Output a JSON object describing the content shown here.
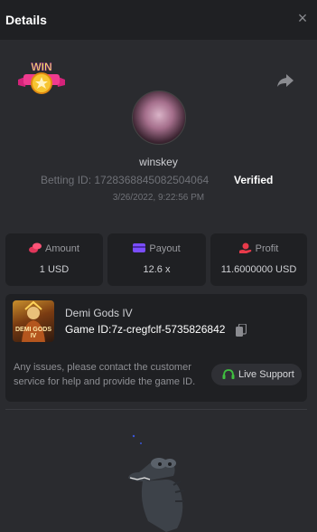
{
  "header": {
    "title": "Details",
    "close_label": "×"
  },
  "profile": {
    "badge_text": "WIN",
    "username": "winskey",
    "betting_id": "Betting ID: 1728368845082504064",
    "verified_label": "Verified",
    "timestamp": "3/26/2022, 9:22:56 PM"
  },
  "stats": [
    {
      "label": "Amount",
      "value": "1 USD",
      "icon": "coins-icon"
    },
    {
      "label": "Payout",
      "value": "12.6 x",
      "icon": "card-icon"
    },
    {
      "label": "Profit",
      "value": "11.6000000 USD",
      "icon": "hand-coins-icon"
    }
  ],
  "game": {
    "name": "Demi Gods IV",
    "game_id": "Game ID:7z-cregfclf-5735826842",
    "thumb_text": "DEMI GODS IV",
    "help_text": "Any issues, please contact the customer service for help and provide the game ID.",
    "support_label": "Live Support"
  },
  "colors": {
    "background": "#2a2b2f",
    "panel": "#1f2023",
    "amount_icon": "#e0365a",
    "payout_icon": "#7a4dfc",
    "profit_icon": "#e83a4a",
    "support_icon": "#3fbf3f"
  }
}
